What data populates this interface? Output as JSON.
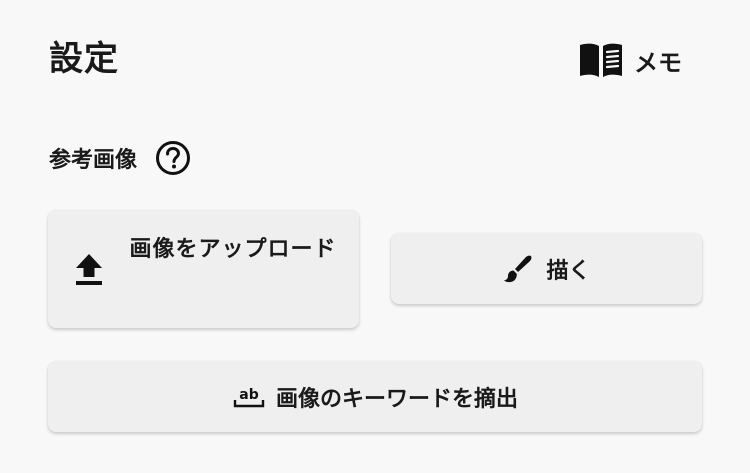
{
  "header": {
    "title": "設定",
    "memo_label": "メモ",
    "memo_icon": "open-book-icon"
  },
  "reference_image": {
    "label": "参考画像",
    "help_icon": "help-circle-icon"
  },
  "buttons": {
    "upload_label": "画像をアップロード",
    "upload_icon": "upload-icon",
    "draw_label": "描く",
    "draw_icon": "brush-icon",
    "extract_label": "画像のキーワードを摘出",
    "extract_icon": "text-abc-icon"
  },
  "colors": {
    "background": "#f8f8f8",
    "button": "#efefef",
    "text": "#1a1a1a"
  }
}
